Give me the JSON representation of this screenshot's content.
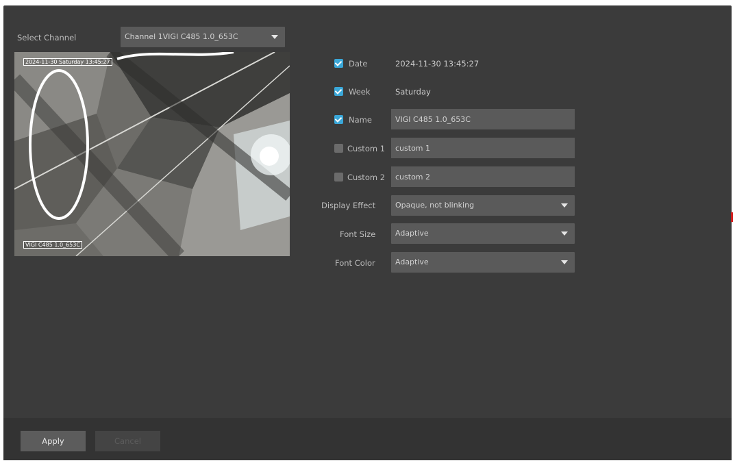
{
  "channel": {
    "label": "Select Channel",
    "selected": "Channel 1VIGI C485 1.0_653C"
  },
  "preview": {
    "osd_time": "2024-11-30 Saturday 13:45:27",
    "osd_name": "VIGI C485 1.0_653C"
  },
  "settings": {
    "date": {
      "label": "Date",
      "checked": true,
      "value": "2024-11-30 13:45:27"
    },
    "week": {
      "label": "Week",
      "checked": true,
      "value": "Saturday"
    },
    "name": {
      "label": "Name",
      "checked": true,
      "value": "VIGI C485 1.0_653C"
    },
    "custom1": {
      "label": "Custom 1",
      "checked": false,
      "value": "custom 1"
    },
    "custom2": {
      "label": "Custom 2",
      "checked": false,
      "value": "custom 2"
    },
    "display_effect": {
      "label": "Display Effect",
      "value": "Opaque, not blinking"
    },
    "font_size": {
      "label": "Font Size",
      "value": "Adaptive"
    },
    "font_color": {
      "label": "Font Color",
      "value": "Adaptive"
    }
  },
  "footer": {
    "apply_label": "Apply",
    "cancel_label": "Cancel"
  },
  "colors": {
    "panel_bg": "#3b3b3b",
    "control_bg": "#5a5a5a",
    "check_on": "#3aa7d8",
    "check_off": "#6b6b6b",
    "footer_bg": "#333333"
  }
}
